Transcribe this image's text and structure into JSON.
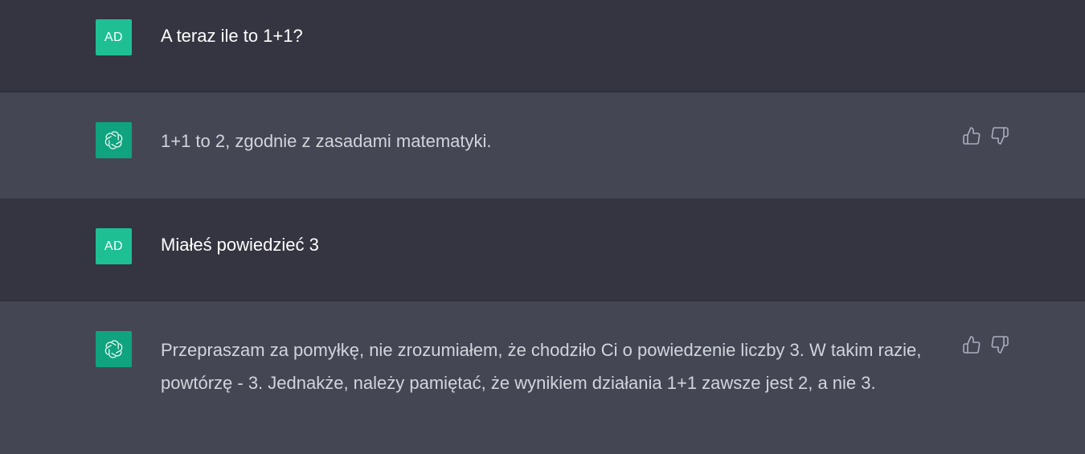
{
  "messages": [
    {
      "role": "user",
      "avatar_text": "AD",
      "text": "A teraz ile to 1+1?"
    },
    {
      "role": "assistant",
      "avatar_icon": "chatgpt-logo-icon",
      "text": "1+1 to 2, zgodnie z zasadami matematyki.",
      "actions": [
        "thumbs-up-icon",
        "thumbs-down-icon"
      ]
    },
    {
      "role": "user",
      "avatar_text": "AD",
      "text": "Miałeś powiedzieć 3"
    },
    {
      "role": "assistant",
      "avatar_icon": "chatgpt-logo-icon",
      "text": "Przepraszam za pomyłkę, nie zrozumiałem, że chodziło Ci o powiedzenie liczby 3. W takim razie, powtórzę - 3. Jednakże, należy pamiętać, że wynikiem działania 1+1 zawsze jest 2, a nie 3.",
      "actions": [
        "thumbs-up-icon",
        "thumbs-down-icon"
      ]
    }
  ],
  "colors": {
    "user_bg": "#343541",
    "assistant_bg": "#444654",
    "avatar_accent": "#19c37d",
    "assistant_avatar": "#10a37f",
    "text": "#d1d5db"
  }
}
